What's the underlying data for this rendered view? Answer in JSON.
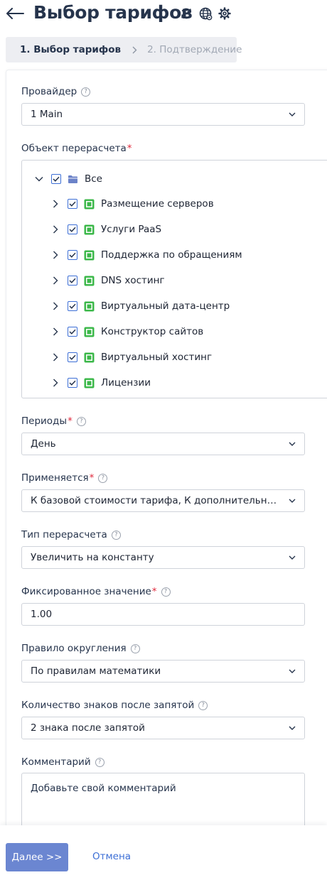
{
  "header": {
    "title": "Выбор тарифов",
    "icons": [
      "arrow-left-icon",
      "refresh-icon",
      "globe-icon",
      "gear-icon"
    ]
  },
  "steps": {
    "step1": "1. Выбор тарифов",
    "step2": "2. Подтверждение"
  },
  "form": {
    "provider": {
      "label": "Провайдер",
      "value": "1 Main"
    },
    "object": {
      "label": "Объект перерасчета",
      "required_mark": "*",
      "root": {
        "label": "Все",
        "checked": true,
        "expanded": true
      },
      "items": [
        {
          "label": "Размещение серверов",
          "checked": true
        },
        {
          "label": "Услуги PaaS",
          "checked": true
        },
        {
          "label": "Поддержка по обращениям",
          "checked": true
        },
        {
          "label": "DNS хостинг",
          "checked": true
        },
        {
          "label": "Виртуальный дата-центр",
          "checked": true
        },
        {
          "label": "Конструктор сайтов",
          "checked": true
        },
        {
          "label": "Виртуальный хостинг",
          "checked": true
        },
        {
          "label": "Лицензии",
          "checked": true
        }
      ]
    },
    "periods": {
      "label": "Периоды",
      "required_mark": "*",
      "value": "День"
    },
    "applies": {
      "label": "Применяется",
      "required_mark": "*",
      "value": "К базовой стоимости тарифа,  К дополнительным ресурсам"
    },
    "recalc_type": {
      "label": "Тип перерасчета",
      "value": "Увеличить на константу"
    },
    "fixed_value": {
      "label": "Фиксированное значение",
      "required_mark": "*",
      "value": "1.00"
    },
    "rounding": {
      "label": "Правило округления",
      "value": "По правилам математики"
    },
    "decimals": {
      "label": "Количество знаков после запятой",
      "value": "2 знака после запятой"
    },
    "comment": {
      "label": "Комментарий",
      "placeholder": "Добавьте свой комментарий"
    }
  },
  "footer": {
    "next_label": "Далее >>",
    "cancel_label": "Отмена"
  },
  "colors": {
    "primary": "#6b86d1",
    "link": "#3d6fd6",
    "required": "#e0283b",
    "folder": "#6b82c8",
    "service": "#3cb84a",
    "title": "#26344c"
  }
}
